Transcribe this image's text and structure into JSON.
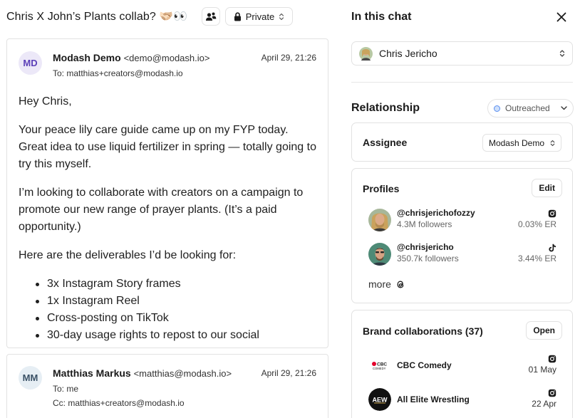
{
  "thread": {
    "title": "Chris X John’s Plants collab? 🫱🏻‍🫲🏼👀",
    "privacy_label": "Private",
    "emails": [
      {
        "initials": "MD",
        "sender_name": "Modash Demo",
        "sender_email": "<demo@modash.io>",
        "date": "April 29, 21:26",
        "to": "To: matthias+creators@modash.io",
        "body": {
          "greeting": "Hey Chris,",
          "p1": "Your peace lily care guide came up on my FYP today. Great idea to use liquid fertilizer in spring — totally going to try this myself.",
          "p2": "I’m looking to collaborate with creators on a campaign to promote our new range of prayer plants. (It’s a paid opportunity.)",
          "p3": "Here are the deliverables I’d be looking for:",
          "deliverables": [
            "3x Instagram Story frames",
            "1x Instagram Reel",
            "Cross-posting on TikTok",
            "30-day usage rights to repost to our social"
          ]
        }
      },
      {
        "initials": "MM",
        "sender_name": "Matthias Markus",
        "sender_email": "<matthias@modash.io>",
        "date": "April 29, 21:26",
        "to": "To: me",
        "cc": "Cc: matthias+creators@modash.io"
      }
    ]
  },
  "panel": {
    "title": "In this chat",
    "contact_name": "Chris Jericho",
    "relationship_title": "Relationship",
    "status": "Outreached",
    "colors": {
      "status_dot": "#5a8ff0",
      "accent_purple": "#5b3fb8"
    },
    "assignee": {
      "label": "Assignee",
      "value": "Modash Demo"
    },
    "profiles": {
      "title": "Profiles",
      "edit_label": "Edit",
      "items": [
        {
          "handle": "@chrisjerichofozzy",
          "followers": "4.3M followers",
          "er": "0.03% ER",
          "platform_icon": "instagram-icon"
        },
        {
          "handle": "@chrisjericho",
          "followers": "350.7k followers",
          "er": "3.44% ER",
          "platform_icon": "tiktok-icon"
        }
      ],
      "more_label": "more",
      "more_icon": "threads-icon"
    },
    "brands": {
      "title": "Brand collaborations (37)",
      "open_label": "Open",
      "items": [
        {
          "name": "CBC Comedy",
          "date": "01 May",
          "platform_icon": "instagram-icon",
          "logo_text": "CBC COMEDY"
        },
        {
          "name": "All Elite Wrestling",
          "date": "22 Apr",
          "platform_icon": "instagram-icon",
          "logo_text": "AEW"
        }
      ]
    }
  }
}
